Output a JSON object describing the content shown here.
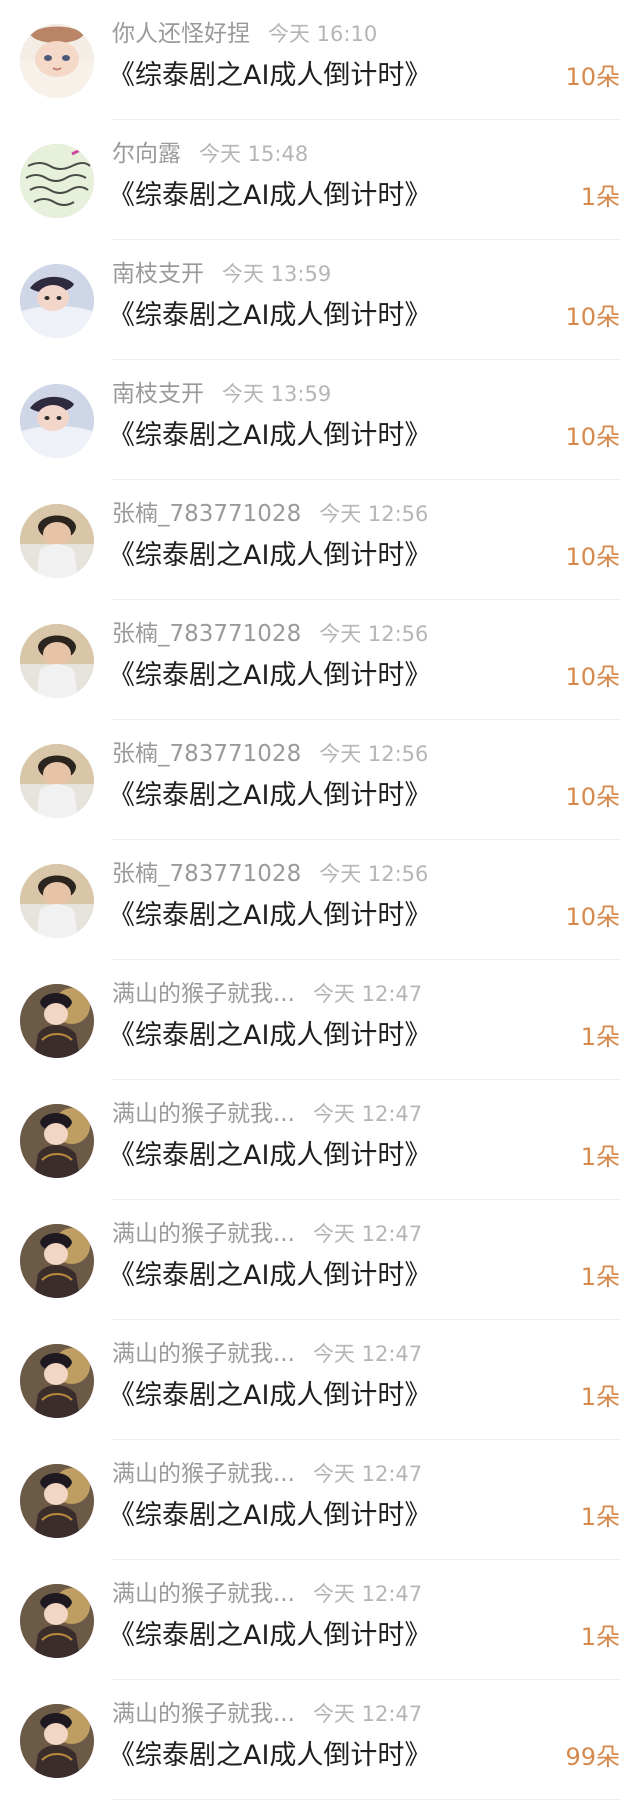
{
  "items": [
    {
      "user": "你人还怪好捏",
      "time": "今天 16:10",
      "title": "《综泰剧之AI成人倒计时》",
      "count": "10朵",
      "avatar": "avatar-anime"
    },
    {
      "user": "尔向露",
      "time": "今天 15:48",
      "title": "《综泰剧之AI成人倒计时》",
      "count": "1朵",
      "avatar": "avatar-handwriting"
    },
    {
      "user": "南枝支开",
      "time": "今天 13:59",
      "title": "《综泰剧之AI成人倒计时》",
      "count": "10朵",
      "avatar": "avatar-man-lying"
    },
    {
      "user": "南枝支开",
      "time": "今天 13:59",
      "title": "《综泰剧之AI成人倒计时》",
      "count": "10朵",
      "avatar": "avatar-man-lying"
    },
    {
      "user": "张楠_783771028",
      "time": "今天 12:56",
      "title": "《综泰剧之AI成人倒计时》",
      "count": "10朵",
      "avatar": "avatar-woman"
    },
    {
      "user": "张楠_783771028",
      "time": "今天 12:56",
      "title": "《综泰剧之AI成人倒计时》",
      "count": "10朵",
      "avatar": "avatar-woman"
    },
    {
      "user": "张楠_783771028",
      "time": "今天 12:56",
      "title": "《综泰剧之AI成人倒计时》",
      "count": "10朵",
      "avatar": "avatar-woman"
    },
    {
      "user": "张楠_783771028",
      "time": "今天 12:56",
      "title": "《综泰剧之AI成人倒计时》",
      "count": "10朵",
      "avatar": "avatar-woman"
    },
    {
      "user": "满山的猴子就我...",
      "time": "今天 12:47",
      "title": "《综泰剧之AI成人倒计时》",
      "count": "1朵",
      "avatar": "avatar-illustration"
    },
    {
      "user": "满山的猴子就我...",
      "time": "今天 12:47",
      "title": "《综泰剧之AI成人倒计时》",
      "count": "1朵",
      "avatar": "avatar-illustration"
    },
    {
      "user": "满山的猴子就我...",
      "time": "今天 12:47",
      "title": "《综泰剧之AI成人倒计时》",
      "count": "1朵",
      "avatar": "avatar-illustration"
    },
    {
      "user": "满山的猴子就我...",
      "time": "今天 12:47",
      "title": "《综泰剧之AI成人倒计时》",
      "count": "1朵",
      "avatar": "avatar-illustration"
    },
    {
      "user": "满山的猴子就我...",
      "time": "今天 12:47",
      "title": "《综泰剧之AI成人倒计时》",
      "count": "1朵",
      "avatar": "avatar-illustration"
    },
    {
      "user": "满山的猴子就我...",
      "time": "今天 12:47",
      "title": "《综泰剧之AI成人倒计时》",
      "count": "1朵",
      "avatar": "avatar-illustration"
    },
    {
      "user": "满山的猴子就我...",
      "time": "今天 12:47",
      "title": "《综泰剧之AI成人倒计时》",
      "count": "99朵",
      "avatar": "avatar-illustration"
    }
  ],
  "colors": {
    "username": "#9a9a9a",
    "time": "#b5b5b5",
    "title": "#1f1f1f",
    "count": "#d6894d",
    "divider": "#efefef"
  }
}
